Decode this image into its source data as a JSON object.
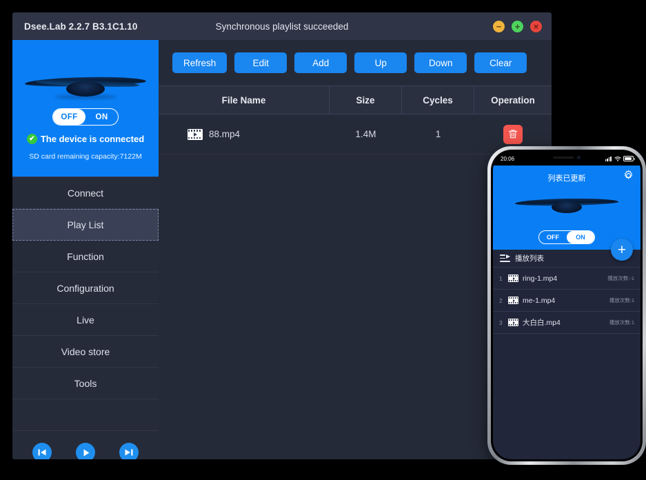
{
  "window": {
    "title": "Dsee.Lab 2.2.7 B3.1C1.10",
    "status_message": "Synchronous playlist succeeded",
    "controls": {
      "minimize": "−",
      "maximize": "+",
      "close": "×"
    }
  },
  "device": {
    "toggle_off": "OFF",
    "toggle_on": "ON",
    "toggle_state": "OFF",
    "status_text": "The device is connected",
    "status_check": "✔",
    "capacity_text": "SD card remaining capacity:7122M",
    "accent_color": "#0a7ff5",
    "status_color": "#36c93c"
  },
  "sidebar": {
    "items": [
      {
        "label": "Connect",
        "active": false
      },
      {
        "label": "Play List",
        "active": true
      },
      {
        "label": "Function",
        "active": false
      },
      {
        "label": "Configuration",
        "active": false
      },
      {
        "label": "Live",
        "active": false
      },
      {
        "label": "Video store",
        "active": false
      },
      {
        "label": "Tools",
        "active": false
      }
    ],
    "player": {
      "previous_label": "previous",
      "play_label": "play",
      "next_label": "next"
    }
  },
  "toolbar": {
    "buttons": [
      {
        "label": "Refresh"
      },
      {
        "label": "Edit"
      },
      {
        "label": "Add"
      },
      {
        "label": "Up"
      },
      {
        "label": "Down"
      },
      {
        "label": "Clear"
      }
    ],
    "button_color": "#1a86f0"
  },
  "table": {
    "columns": [
      "File Name",
      "Size",
      "Cycles",
      "Operation"
    ],
    "rows": [
      {
        "file_name": "88.mp4",
        "size": "1.4M",
        "cycles": "1",
        "operation": "delete"
      }
    ],
    "delete_color": "#f4564f"
  },
  "phone": {
    "statusbar": {
      "time": "20:06"
    },
    "hero": {
      "title": "列表已更新",
      "toggle_off": "OFF",
      "toggle_on": "ON",
      "toggle_state": "ON"
    },
    "fab_label": "+",
    "playlist_header": "播放列表",
    "rows": [
      {
        "index": "1",
        "name": "ring-1.mp4",
        "count": "播放次数:-1"
      },
      {
        "index": "2",
        "name": "me-1.mp4",
        "count": "播放次数:1"
      },
      {
        "index": "3",
        "name": "大白白.mp4",
        "count": "播放次数:1"
      }
    ]
  }
}
